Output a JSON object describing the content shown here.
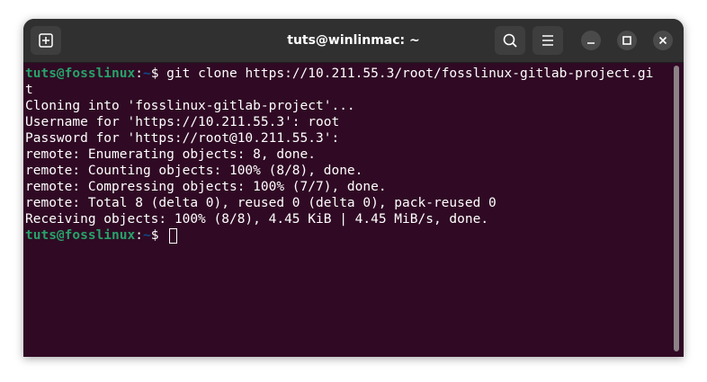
{
  "window": {
    "title": "tuts@winlinmac: ~"
  },
  "titlebar": {
    "new_tab_icon": "new-tab-icon",
    "search_icon": "search-icon",
    "menu_icon": "hamburger-menu-icon",
    "minimize_icon": "minimize-icon",
    "maximize_icon": "maximize-icon",
    "close_icon": "close-icon"
  },
  "terminal": {
    "colors": {
      "background": "#300a24",
      "prompt_user": "#26a269",
      "prompt_path": "#12488b",
      "text": "#ffffff"
    },
    "prompt": {
      "user_host": "tuts@fosslinux",
      "colon": ":",
      "path": "~",
      "symbol": "$"
    },
    "command": " git clone https://10.211.55.3/root/fosslinux-gitlab-project.gi",
    "command_wrap": "t",
    "output": [
      "Cloning into 'fosslinux-gitlab-project'...",
      "Username for 'https://10.211.55.3': root",
      "Password for 'https://root@10.211.55.3':",
      "remote: Enumerating objects: 8, done.",
      "remote: Counting objects: 100% (8/8), done.",
      "remote: Compressing objects: 100% (7/7), done.",
      "remote: Total 8 (delta 0), reused 0 (delta 0), pack-reused 0",
      "Receiving objects: 100% (8/8), 4.45 KiB | 4.45 MiB/s, done."
    ],
    "prompt2": {
      "user_host": "tuts@fosslinux",
      "colon": ":",
      "path": "~",
      "symbol": "$ "
    }
  }
}
